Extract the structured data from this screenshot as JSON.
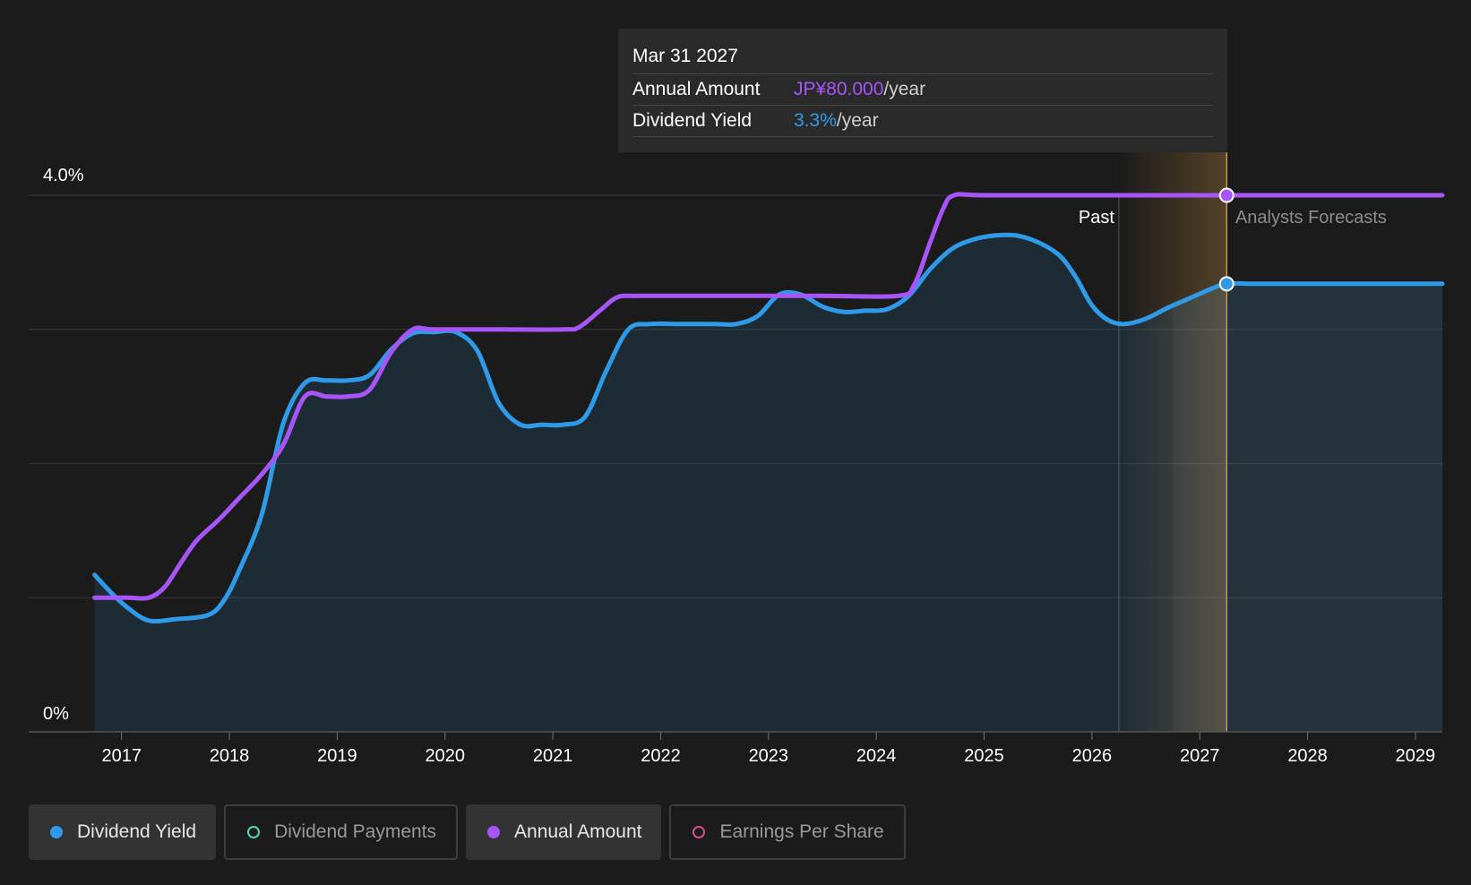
{
  "tooltip": {
    "date": "Mar 31 2027",
    "rows": [
      {
        "label": "Annual Amount",
        "value": "JP¥80.000",
        "unit": "/year",
        "color": "#a855f7"
      },
      {
        "label": "Dividend Yield",
        "value": "3.3%",
        "unit": "/year",
        "color": "#2f9be8"
      }
    ]
  },
  "legend": [
    {
      "label": "Dividend Yield",
      "color": "#2f9be8",
      "active": true,
      "icon": "filled-dot-icon"
    },
    {
      "label": "Dividend Payments",
      "color": "#5ad1b5",
      "active": false,
      "icon": "hollow-dot-icon"
    },
    {
      "label": "Annual Amount",
      "color": "#a855f7",
      "active": true,
      "icon": "filled-dot-icon"
    },
    {
      "label": "Earnings Per Share",
      "color": "#d24d8a",
      "active": false,
      "icon": "hollow-dot-icon"
    }
  ],
  "chart_data": {
    "type": "line",
    "y_tick_labels": [
      "4.0%",
      "0%"
    ],
    "ylim": [
      0,
      4.0
    ],
    "xlim": [
      2016.67,
      2029.25
    ],
    "x_ticks": [
      "2017",
      "2018",
      "2019",
      "2020",
      "2021",
      "2022",
      "2023",
      "2024",
      "2025",
      "2026",
      "2027",
      "2028",
      "2029"
    ],
    "grid": true,
    "past_label": "Past",
    "forecast_label": "Analysts Forecasts",
    "past_end": 2026.25,
    "forecast_start": 2026.75,
    "highlight_x": 2027.25,
    "series": [
      {
        "name": "Dividend Yield",
        "color": "#2f9be8",
        "fill": true,
        "points": [
          [
            2016.75,
            1.17
          ],
          [
            2016.9,
            1.04
          ],
          [
            2017.05,
            0.93
          ],
          [
            2017.25,
            0.83
          ],
          [
            2017.5,
            0.84
          ],
          [
            2017.8,
            0.87
          ],
          [
            2017.95,
            0.98
          ],
          [
            2018.1,
            1.22
          ],
          [
            2018.3,
            1.62
          ],
          [
            2018.5,
            2.3
          ],
          [
            2018.7,
            2.6
          ],
          [
            2018.9,
            2.62
          ],
          [
            2019.1,
            2.62
          ],
          [
            2019.3,
            2.66
          ],
          [
            2019.5,
            2.85
          ],
          [
            2019.7,
            2.97
          ],
          [
            2019.9,
            2.98
          ],
          [
            2020.1,
            2.98
          ],
          [
            2020.3,
            2.84
          ],
          [
            2020.5,
            2.45
          ],
          [
            2020.7,
            2.29
          ],
          [
            2020.9,
            2.29
          ],
          [
            2021.1,
            2.29
          ],
          [
            2021.3,
            2.35
          ],
          [
            2021.5,
            2.7
          ],
          [
            2021.7,
            3.0
          ],
          [
            2021.9,
            3.04
          ],
          [
            2022.2,
            3.04
          ],
          [
            2022.5,
            3.04
          ],
          [
            2022.7,
            3.04
          ],
          [
            2022.9,
            3.1
          ],
          [
            2023.1,
            3.26
          ],
          [
            2023.3,
            3.26
          ],
          [
            2023.5,
            3.17
          ],
          [
            2023.7,
            3.13
          ],
          [
            2023.9,
            3.14
          ],
          [
            2024.1,
            3.15
          ],
          [
            2024.3,
            3.25
          ],
          [
            2024.5,
            3.45
          ],
          [
            2024.7,
            3.6
          ],
          [
            2024.9,
            3.67
          ],
          [
            2025.1,
            3.7
          ],
          [
            2025.3,
            3.7
          ],
          [
            2025.5,
            3.65
          ],
          [
            2025.7,
            3.55
          ],
          [
            2025.85,
            3.39
          ],
          [
            2026.0,
            3.18
          ],
          [
            2026.15,
            3.07
          ],
          [
            2026.3,
            3.04
          ],
          [
            2026.5,
            3.08
          ],
          [
            2026.7,
            3.16
          ],
          [
            2026.9,
            3.23
          ],
          [
            2027.1,
            3.3
          ],
          [
            2027.25,
            3.34
          ],
          [
            2027.5,
            3.34
          ],
          [
            2028.0,
            3.34
          ],
          [
            2028.5,
            3.34
          ],
          [
            2029.0,
            3.34
          ],
          [
            2029.25,
            3.34
          ]
        ]
      },
      {
        "name": "Annual Amount",
        "color": "#a855f7",
        "fill": false,
        "points": [
          [
            2016.75,
            1.0
          ],
          [
            2017.05,
            1.0
          ],
          [
            2017.25,
            1.0
          ],
          [
            2017.4,
            1.08
          ],
          [
            2017.55,
            1.26
          ],
          [
            2017.7,
            1.43
          ],
          [
            2017.9,
            1.58
          ],
          [
            2018.1,
            1.75
          ],
          [
            2018.3,
            1.92
          ],
          [
            2018.5,
            2.14
          ],
          [
            2018.7,
            2.5
          ],
          [
            2018.9,
            2.5
          ],
          [
            2019.1,
            2.5
          ],
          [
            2019.3,
            2.55
          ],
          [
            2019.5,
            2.83
          ],
          [
            2019.7,
            3.0
          ],
          [
            2019.9,
            3.0
          ],
          [
            2020.5,
            3.0
          ],
          [
            2021.1,
            3.0
          ],
          [
            2021.25,
            3.02
          ],
          [
            2021.45,
            3.15
          ],
          [
            2021.6,
            3.24
          ],
          [
            2021.8,
            3.25
          ],
          [
            2022.5,
            3.25
          ],
          [
            2023.5,
            3.25
          ],
          [
            2024.2,
            3.25
          ],
          [
            2024.35,
            3.33
          ],
          [
            2024.5,
            3.65
          ],
          [
            2024.62,
            3.9
          ],
          [
            2024.72,
            4.0
          ],
          [
            2025.0,
            4.0
          ],
          [
            2026.0,
            4.0
          ],
          [
            2027.0,
            4.0
          ],
          [
            2027.25,
            4.0
          ],
          [
            2028.0,
            4.0
          ],
          [
            2029.0,
            4.0
          ],
          [
            2029.25,
            4.0
          ]
        ]
      }
    ]
  }
}
